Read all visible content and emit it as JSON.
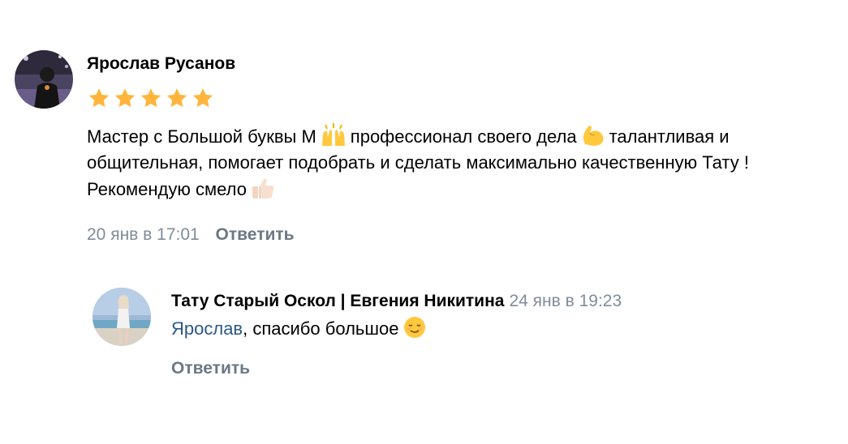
{
  "comment": {
    "author": "Ярослав Русанов",
    "rating": 5,
    "text_part1": "Мастер с Большой буквы М",
    "text_part2": "профессионал своего дела",
    "text_part3": "талантливая и общительная, помогает подобрать и сделать максимально качественную Тату ! Рекомендую смело",
    "date": "20 янв в 17:01",
    "reply_label": "Ответить"
  },
  "reply": {
    "author": "Тату Старый Оскол | Евгения Никитина",
    "date": "24 янв в 19:23",
    "mention": "Ярослав",
    "text": ", спасибо большое",
    "reply_label": "Ответить"
  },
  "colors": {
    "star": "#ffb53c",
    "date": "#818c99",
    "action": "#6d7885",
    "mention": "#2a5885"
  },
  "icons": [
    "star-icon",
    "raising-hands-emoji",
    "flexed-biceps-emoji",
    "thumbs-up-emoji",
    "relieved-face-emoji"
  ]
}
